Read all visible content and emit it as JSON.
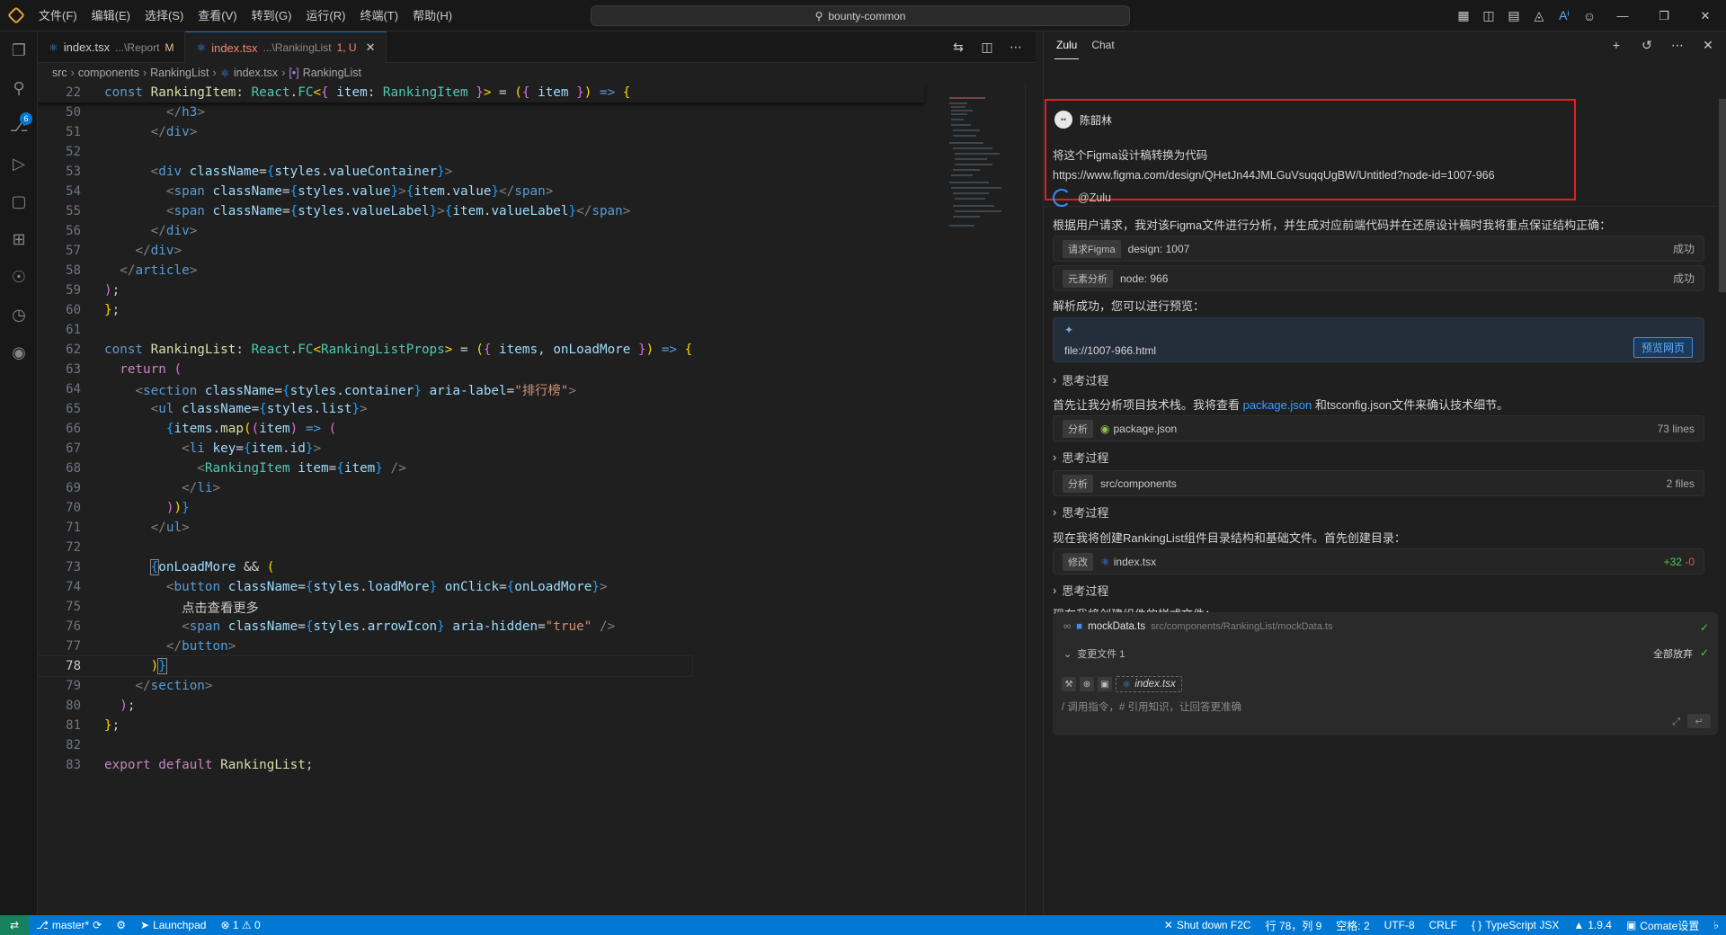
{
  "titlebar": {
    "menu": [
      "文件(F)",
      "编辑(E)",
      "选择(S)",
      "查看(V)",
      "转到(G)",
      "运行(R)",
      "终端(T)",
      "帮助(H)"
    ],
    "search": "bounty-common"
  },
  "activity": {
    "scm_badge": "6"
  },
  "tabs": [
    {
      "name": "index.tsx",
      "desc": "...\\Report",
      "mod": "M",
      "active": false
    },
    {
      "name": "index.tsx",
      "desc": "...\\RankingList",
      "mod": "1, U",
      "active": true
    }
  ],
  "breadcrumb": [
    "src",
    "components",
    "RankingList",
    "index.tsx",
    "RankingList"
  ],
  "editor": {
    "sticky": {
      "num": "22"
    },
    "current_line": "78"
  },
  "chat": {
    "tabs": [
      "Zulu",
      "Chat"
    ],
    "user": {
      "avatar": "••",
      "name": "陈韶林",
      "line1": "将这个Figma设计稿转换为代码",
      "line2": "https://www.figma.com/design/QHetJn44JMLGuVsuqqUgBW/Untitled?node-id=1007-966"
    },
    "bot": {
      "name": "@Zulu",
      "intro": "根据用户请求，我对该Figma文件进行分析，并生成对应前端代码并在还原设计稿时我将重点保证结构正确：",
      "tool1": {
        "tag": "请求Figma",
        "text": "design: 1007",
        "status": "成功"
      },
      "tool2": {
        "tag": "元素分析",
        "text": "node: 966",
        "status": "成功"
      },
      "parse_ok": "解析成功，您可以进行预览：",
      "preview_file": "file://1007-966.html",
      "preview_btn": "预览网页",
      "think": "思考过程",
      "p2_a": "首先让我分析项目技术栈。我将查看",
      "p2_link": "package.json",
      "p2_b": "和tsconfig.json文件来确认技术细节。",
      "tool3": {
        "tag": "分析",
        "text": "package.json",
        "status": "73 lines"
      },
      "tool4": {
        "tag": "分析",
        "text": "src/components",
        "status": "2 files"
      },
      "p3": "现在我将创建RankingList组件目录结构和基础文件。首先创建目录：",
      "tool5": {
        "tag": "修改",
        "text": "index.tsx",
        "add": "+32",
        "del": "-0"
      },
      "p4": "现在我将创建组件的样式文件："
    },
    "changes": {
      "file": "mockData.ts",
      "path": "src/components/RankingList/mockData.ts",
      "summary": "变更文件 1",
      "discard": "全部放弃"
    },
    "input": {
      "chip": "index.tsx",
      "placeholder": "/ 调用指令，# 引用知识，让回答更准确"
    }
  },
  "statusbar": {
    "branch": "master*",
    "launchpad": "Launchpad",
    "problems": "⊗ 1 ⚠ 0",
    "f2c": "Shut down F2C",
    "position": "行 78，列 9",
    "spaces": "空格: 2",
    "encoding": "UTF-8",
    "eol": "CRLF",
    "language": "TypeScript JSX",
    "version": "1.9.4",
    "comate": "Comate设置"
  },
  "colors": {
    "accent": "#0078d4",
    "highlight_border": "#e02020",
    "statusbar": "#0078d4"
  }
}
